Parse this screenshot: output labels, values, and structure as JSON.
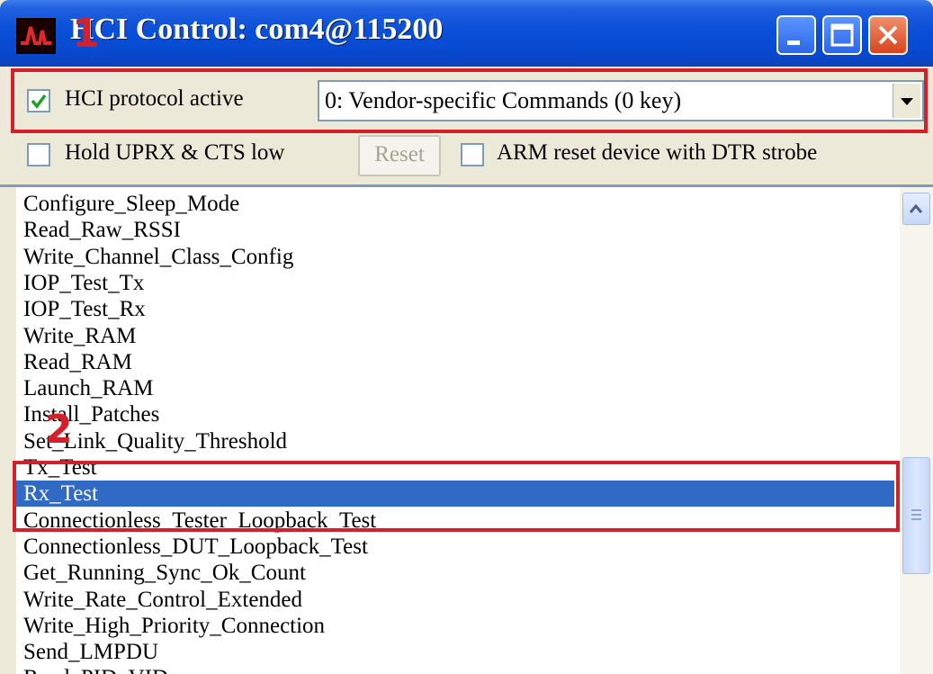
{
  "window": {
    "title": "HCI Control: com4@115200",
    "accent": "#0a4fd8",
    "buttons": [
      "minimize-icon",
      "maximize-icon",
      "close-icon"
    ]
  },
  "toolbar": {
    "hci_active_label": "HCI protocol active",
    "hci_active_checked": true,
    "command_set_selected": "0: Vendor-specific Commands (0 key)",
    "hold_label": "Hold UPRX & CTS low",
    "hold_checked": false,
    "reset_label": "Reset",
    "arm_reset_label": "ARM reset device with DTR strobe",
    "arm_reset_checked": false
  },
  "commands": {
    "items": [
      "Configure_Sleep_Mode",
      "Read_Raw_RSSI",
      "Write_Channel_Class_Config",
      "IOP_Test_Tx",
      "IOP_Test_Rx",
      "Write_RAM",
      "Read_RAM",
      "Launch_RAM",
      "Install_Patches",
      "Set_Link_Quality_Threshold",
      "Tx_Test",
      "Rx_Test",
      "Connectionless_Tester_Loopback_Test",
      "Connectionless_DUT_Loopback_Test",
      "Get_Running_Sync_Ok_Count",
      "Write_Rate_Control_Extended",
      "Write_High_Priority_Connection",
      "Send_LMPDU",
      "Read_PID_VID"
    ],
    "selected": "Rx_Test",
    "selection_color": "#316ac5"
  },
  "annotations": {
    "marker_1": "1",
    "marker_2": "2",
    "color": "#d4202a"
  }
}
